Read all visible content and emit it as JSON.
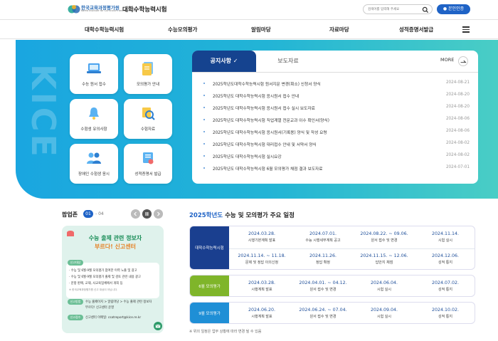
{
  "header": {
    "logo_org": "한국교육과정평가원",
    "logo_sub": "Korea Institute for Curriculum and Evaluation",
    "site_title": "대학수학능력시험",
    "search_placeholder": "검색어를 입력해 주세요",
    "auth_label": "본인인증"
  },
  "nav": {
    "items": [
      "대학수학능력시험",
      "수능모의평가",
      "알림마당",
      "자료마당",
      "성적증명서발급"
    ]
  },
  "hero": {
    "watermark": "KICE",
    "quick_links": [
      {
        "label": "수능 원서 접수",
        "icon": "laptop-icon"
      },
      {
        "label": "모의평가 안내",
        "icon": "document-icon"
      },
      {
        "label": "수험생 유의사항",
        "icon": "bell-icon"
      },
      {
        "label": "수험자료",
        "icon": "magnifier-icon"
      },
      {
        "label": "장애인 수험생 응시",
        "icon": "people-icon"
      },
      {
        "label": "성적증명서 발급",
        "icon": "certificate-icon"
      }
    ]
  },
  "board": {
    "tabs": [
      "공지사항",
      "보도자료"
    ],
    "more_label": "MORE",
    "notices": [
      {
        "title": "2025학년도대학수학능력시험 원서지문 변경(취소) 신청서 양식",
        "date": "2024-08-21"
      },
      {
        "title": "2025학년도 대학수학능력시험 응시원서 접수 안내",
        "date": "2024-08-20"
      },
      {
        "title": "2025학년도 대학수학능력시험 응시원서 접수 실시 보도자료",
        "date": "2024-08-20"
      },
      {
        "title": "2025학년도 대학수학능력시험 직업계열 전문교과 이수 확인서(양식)",
        "date": "2024-08-06"
      },
      {
        "title": "2025학년도 대학수학능력시험 응시원서(기록용) 양식 및 작성 요령",
        "date": "2024-08-06"
      },
      {
        "title": "2025학년도 대학수학능력시험 대리접수 안내 및 서약서 양식",
        "date": "2024-08-02"
      },
      {
        "title": "2025학년도 대학수학능력시험 실시요강",
        "date": "2024-08-02"
      },
      {
        "title": "2025학년도 대학수학능력시험 6월 모의평가 채점 결과 보도자료",
        "date": "2024-07-01"
      }
    ]
  },
  "popup": {
    "title": "팝업존",
    "current": "01",
    "total": "04",
    "card": {
      "headline1": "수능 출제 관련 정보자",
      "headline2": "부르다! 신고센터",
      "badge1": "신고대상",
      "lines": [
        "· 수능 및 6월·9월 모의평가 참여한 이력 노출 및 광고",
        "· 수능 및 6월·9월 모의평가 출제 및 검토 관련 내용 광고",
        "· 문항 판매, 교재, 사교육업체에서 개최 등",
        "※ 한국교육과정평가원 신고 대상이 아닙니다."
      ],
      "badge2": "신고방법",
      "method": "수능 홈페이지 > 알림마당 > 수능 출제 관련 정보자",
      "method2": "부르다! 신고센터 운영",
      "badge3": "신고접수",
      "email": "신고센터 이메일: csatreport@kice.re.kr"
    }
  },
  "schedule": {
    "year": "2025학년도",
    "title_rest": "수능 및 모의평가 주요 일정",
    "groups": [
      {
        "label": "대학수학능력시험",
        "color": "#1a3f8f",
        "rows": [
          [
            {
              "date": "2024.03.28.",
              "event": "시행기본계획 발표"
            },
            {
              "date": "2024.07.01.",
              "event": "수능 시행세부계획 공고"
            },
            {
              "date": "2024.08.22. ~ 09.06.",
              "event": "원서 접수 및 변경"
            },
            {
              "date": "2024.11.14.",
              "event": "시험 실시"
            }
          ],
          [
            {
              "date": "2024.11.14. ~ 11.18.",
              "event": "문제 및 정답 이의신청"
            },
            {
              "date": "2024.11.26.",
              "event": "정답 확정"
            },
            {
              "date": "2024.11.15. ~ 12.06.",
              "event": "답안지 채점"
            },
            {
              "date": "2024.12.06.",
              "event": "성적 통지"
            }
          ]
        ]
      },
      {
        "label": "6월 모의평가",
        "color": "#7fb52a",
        "rows": [
          [
            {
              "date": "2024.03.28.",
              "event": "시행계획 발표"
            },
            {
              "date": "2024.04.01. ~ 04.12.",
              "event": "원서 접수 및 변경"
            },
            {
              "date": "2024.06.04.",
              "event": "시험 실시"
            },
            {
              "date": "2024.07.02.",
              "event": "성적 통지"
            }
          ]
        ]
      },
      {
        "label": "9월 모의평가",
        "color": "#1f8fd6",
        "rows": [
          [
            {
              "date": "2024.06.20.",
              "event": "시행계획 발표"
            },
            {
              "date": "2024.06.24. ~ 07.04.",
              "event": "원서 접수 및 변경"
            },
            {
              "date": "2024.09.04.",
              "event": "시험 실시"
            },
            {
              "date": "2024.10.02.",
              "event": "성적 통지"
            }
          ]
        ]
      }
    ],
    "note": "※ 위의 일정은 업무 상황에 따라 변경 될 수 있음"
  }
}
